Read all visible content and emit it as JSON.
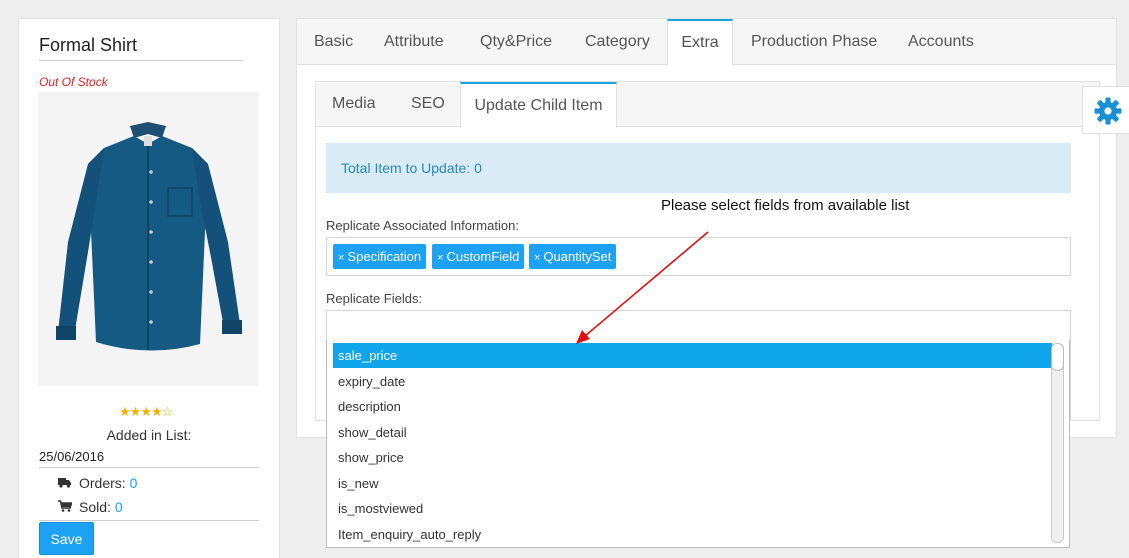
{
  "product": {
    "title": "Formal Shirt",
    "stock_status": "Out Of Stock",
    "rating": 4,
    "rating_max": 5,
    "added_label": "Added in List:",
    "added_date": "25/06/2016",
    "orders_label": "Orders:",
    "orders_value": "0",
    "sold_label": "Sold:",
    "sold_value": "0",
    "save_label": "Save"
  },
  "top_tabs": [
    {
      "label": "Basic"
    },
    {
      "label": "Attribute"
    },
    {
      "label": "Qty&Price"
    },
    {
      "label": "Category"
    },
    {
      "label": "Extra"
    },
    {
      "label": "Production Phase"
    },
    {
      "label": "Accounts"
    }
  ],
  "active_top_tab": "Extra",
  "sub_tabs": [
    {
      "label": "Media"
    },
    {
      "label": "SEO"
    },
    {
      "label": "Update Child Item"
    }
  ],
  "active_sub_tab": "Update Child Item",
  "info": {
    "text": "Total Item to Update: 0"
  },
  "replicate_assoc": {
    "label": "Replicate Associated Information:",
    "tags": [
      "Specification",
      "CustomField",
      "QuantitySet"
    ],
    "remove_glyph": "×"
  },
  "replicate_fields": {
    "label": "Replicate Fields:"
  },
  "dropdown": {
    "options": [
      "sale_price",
      "expiry_date",
      "description",
      "show_detail",
      "show_price",
      "is_new",
      "is_mostviewed",
      "Item_enquiry_auto_reply"
    ],
    "highlighted": "sale_price"
  },
  "annotation": {
    "text": "Please select fields from available list"
  },
  "colors": {
    "accent": "#1da1f2",
    "alert": "#e02020",
    "info_bg": "#d9ecf5",
    "info_text": "#2a86b8",
    "arrow": "#e01010"
  },
  "icons": {
    "settings": "gear-icon",
    "orders": "truck-icon",
    "sold": "cart-icon",
    "rating": "star-icon"
  }
}
